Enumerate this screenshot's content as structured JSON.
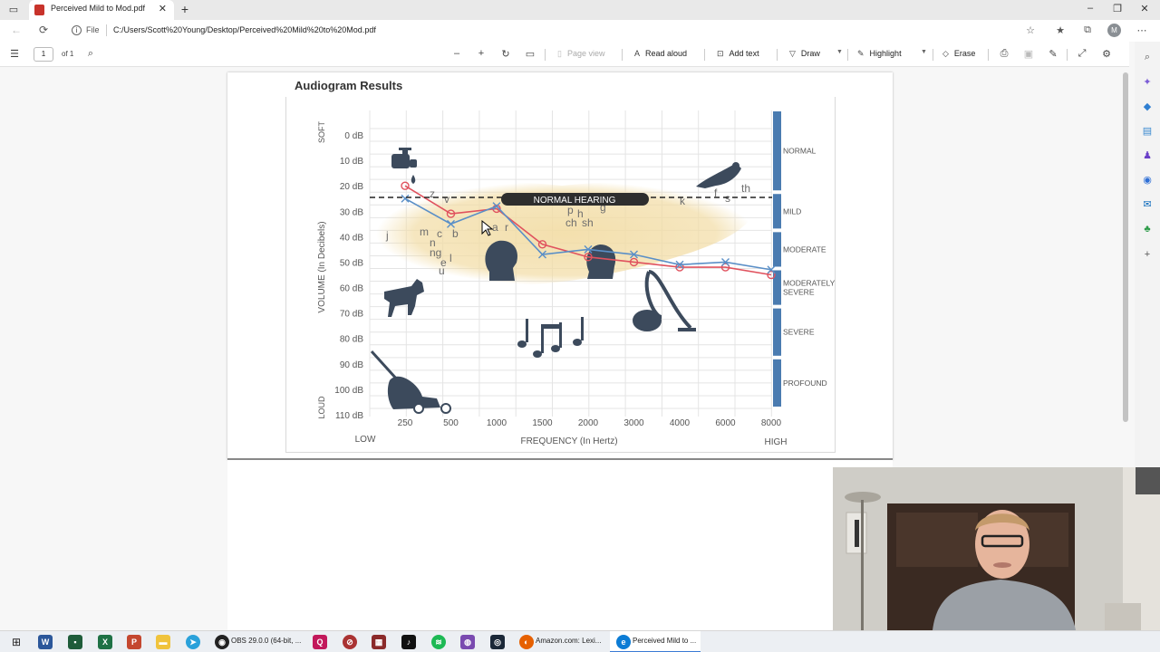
{
  "browser": {
    "tab_title": "Perceived Mild to Mod.pdf",
    "file_label": "File",
    "url": "C:/Users/Scott%20Young/Desktop/Perceived%20Mild%20to%20Mod.pdf",
    "avatar_letter": "M"
  },
  "pdf_toolbar": {
    "page_number": "1",
    "page_count": "of 1",
    "page_view": "Page view",
    "read_aloud": "Read aloud",
    "add_text": "Add text",
    "draw": "Draw",
    "highlight": "Highlight",
    "erase": "Erase"
  },
  "document": {
    "title": "Audiogram Results"
  },
  "chart_data": {
    "type": "line",
    "title": "Audiogram Results",
    "xlabel": "FREQUENCY (In Hertz)",
    "ylabel": "VOLUME (In Decibels)",
    "x_low_label": "LOW",
    "x_high_label": "HIGH",
    "y_top_label": "SOFT",
    "y_bottom_label": "LOUD",
    "x_ticks": [
      "250",
      "500",
      "1000",
      "1500",
      "2000",
      "3000",
      "4000",
      "6000",
      "8000"
    ],
    "y_ticks": [
      "0 dB",
      "10 dB",
      "20 dB",
      "30 dB",
      "40 dB",
      "50 dB",
      "60 dB",
      "70 dB",
      "80 dB",
      "90 dB",
      "100 dB",
      "110 dB"
    ],
    "ylim": [
      0,
      110
    ],
    "grid": true,
    "threshold_label": "NORMAL HEARING",
    "threshold_db": 25,
    "series": [
      {
        "values": [
          20,
          31,
          29,
          43,
          48,
          50,
          52,
          52,
          55
        ],
        "color": "#e0525e",
        "marker": "o"
      },
      {
        "values": [
          25,
          35,
          28,
          47,
          45,
          47,
          51,
          50,
          53
        ],
        "color": "#5a8fc7",
        "marker": "x"
      }
    ],
    "bands": [
      {
        "label": "NORMAL",
        "from": 0,
        "to": 25
      },
      {
        "label": "MILD",
        "from": 25,
        "to": 40
      },
      {
        "label": "MODERATE",
        "from": 40,
        "to": 55
      },
      {
        "label": "MODERATELY SEVERE",
        "from": 55,
        "to": 70
      },
      {
        "label": "SEVERE",
        "from": 70,
        "to": 90
      },
      {
        "label": "PROFOUND",
        "from": 90,
        "to": 110
      }
    ],
    "speech_sounds": [
      "z",
      "v",
      "j",
      "m",
      "c",
      "b",
      "n",
      "ng",
      "e",
      "l",
      "u",
      "a",
      "r",
      "p",
      "h",
      "g",
      "ch",
      "sh",
      "k",
      "f",
      "s",
      "th"
    ],
    "icons": [
      "faucet-icon",
      "bird-icon",
      "dog-icon",
      "music-notes-icon",
      "vacuum-icon",
      "lawn-mower-icon",
      "head-icon"
    ]
  },
  "taskbar": {
    "obs": "OBS 29.0.0 (64-bit, ...",
    "firefox": "Amazon.com: Lexi...",
    "edge": "Perceived Mild to ..."
  },
  "colors": {
    "accent": "#3a7bd5",
    "band_bar": "#4a7bb0",
    "speech_banana": "#f2dca4",
    "red_series": "#e0525e",
    "blue_series": "#5a8fc7"
  }
}
